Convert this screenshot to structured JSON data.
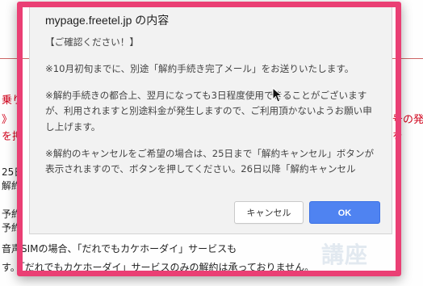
{
  "background": {
    "left_red_lines": [
      "乗り",
      "》",
      "を押"
    ],
    "left_fragments": [
      "25日",
      "解約",
      "予約",
      "予約"
    ],
    "right_red_lines": [
      "号の発",
      "を"
    ],
    "bottom_lines": [
      "音声SIMの場合、「だれでもカケホーダイ」サービスも",
      "す。「だれでもカケホーダイ」サービスのみの解約は承っておりません。"
    ],
    "watermark": "講座"
  },
  "dialog": {
    "title": "mypage.freetel.jp の内容",
    "body": [
      "【ご確認ください！】",
      "※10月初旬までに、別途「解約手続き完了メール」をお送りいたします。",
      "※解約手続きの都合上、翌月になっても3日程度使用できることがございますが、利用されますと別途料金が発生しますので、ご利用頂かないようお願い申し上げます。",
      "※解約のキャンセルをご希望の場合は、25日まで「解約キャンセル」ボタンが表示されますので、ボタンを押してください。26日以降「解約キャンセル"
    ],
    "cancel_label": "キャンセル",
    "ok_label": "OK"
  },
  "colors": {
    "highlight_frame": "#ea3f74",
    "ok_button": "#4f83f1",
    "background_red": "#d0021b"
  },
  "icons": {
    "cursor": "mouse-pointer-icon"
  }
}
